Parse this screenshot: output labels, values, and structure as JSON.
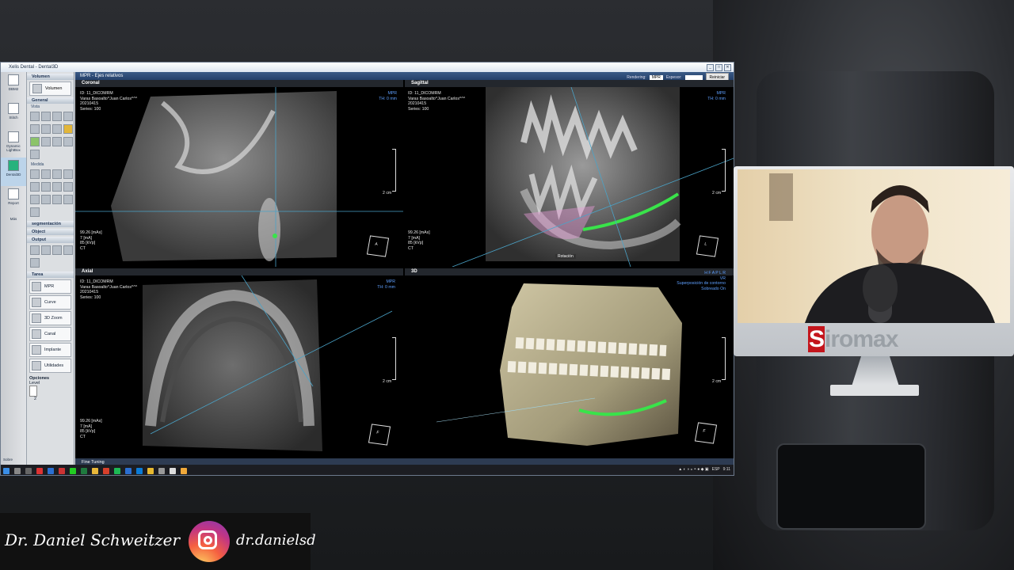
{
  "window": {
    "title": "Xelis Dental - Dental3D",
    "controls": [
      "_",
      "□",
      "✕"
    ]
  },
  "sidebar": {
    "items": [
      {
        "label": "DBM2",
        "icon": "database-icon"
      },
      {
        "label": "Stitch",
        "icon": "stitch-icon"
      },
      {
        "label": "Dynamic LightBox",
        "icon": "lightbox-icon"
      },
      {
        "label": "Dental3D",
        "icon": "dental3d-icon"
      },
      {
        "label": "Report",
        "icon": "report-icon"
      },
      {
        "label": "Más"
      }
    ],
    "footer": "Sobre"
  },
  "panel": {
    "volumen": {
      "header": "Volumen",
      "button": "Volumen"
    },
    "general": {
      "header": "General",
      "vista": "Vista",
      "medida": "Medida"
    },
    "sections": [
      "segmentación",
      "Object",
      "Output"
    ],
    "tarea": {
      "header": "Tarea",
      "items": [
        "MPR",
        "Curve",
        "3D Zoom",
        "Canal",
        "Implante",
        "Utilidades"
      ]
    },
    "opciones": {
      "label": "Opciones",
      "level_label": "Level",
      "level_value": "2"
    }
  },
  "views": {
    "toolbar": {
      "title": "MPR - Ejes relativos",
      "rendering_label": "Rendering:",
      "rendering_value": "MPR",
      "espesor_label": "Espesor:",
      "espesor_value": "",
      "reset_button": "Reiniciar"
    },
    "coronal": {
      "title": "Coronal",
      "info": [
        "ID: 11_DICOMRM",
        "Varas Basoalto^Juan Carlos^^^",
        "20210415",
        "Series: 100"
      ],
      "mode": [
        "MPR",
        "TH: 0 mm"
      ],
      "scale": "2 cm",
      "exposure": [
        "99.26 [mAs]",
        "7 [mA]",
        "85 [kVp]",
        "CT"
      ]
    },
    "sagittal": {
      "title": "Sagittal",
      "info": [
        "ID: 11_DICOMRM",
        "Varas Basoalto^Juan Carlos^^^",
        "20210415",
        "Series: 100"
      ],
      "mode": [
        "MPR",
        "TH: 0 mm"
      ],
      "scale": "2 cm",
      "exposure": [
        "99.26 [mAs]",
        "7 [mA]",
        "85 [kVp]",
        "CT"
      ],
      "overlay": "Rotación"
    },
    "axial": {
      "title": "Axial",
      "info": [
        "ID: 11_DICOMRM",
        "Varas Basoalto^Juan Carlos^^^",
        "20210415",
        "Series: 100"
      ],
      "mode": [
        "MPR",
        "TH: 0 mm"
      ],
      "scale": "2 cm",
      "exposure": [
        "99.26 [mAs]",
        "7 [mA]",
        "85 [kVp]",
        "CT"
      ]
    },
    "view3d": {
      "title": "3D",
      "mode": [
        "H F A P L R",
        "VR",
        "Superposición de contorno",
        "Sobreado On"
      ],
      "scale": "2 cm"
    },
    "fine_tuning": "Fine Tuning"
  },
  "taskbar": {
    "language": "ESP",
    "time": "9:11"
  },
  "overlay": {
    "brand_first": "S",
    "brand_rest": "iromax",
    "author": "Dr. Daniel Schweitzer",
    "instagram": "dr.danielsd"
  },
  "colors": {
    "accent": "#2a4a78",
    "nerve_canal": "#39e34a",
    "instagram_gradient": "#c13584",
    "siromax_red": "#c4151c"
  }
}
